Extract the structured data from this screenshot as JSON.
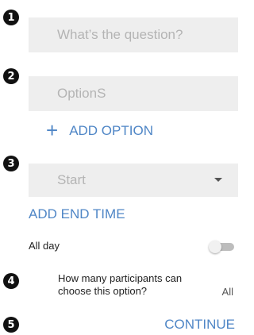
{
  "steps": [
    "1",
    "2",
    "3",
    "4",
    "5"
  ],
  "question": {
    "placeholder": "What’s the question?"
  },
  "option": {
    "placeholder": "OptionS"
  },
  "add_option": {
    "icon": "plus-icon",
    "label": "ADD OPTION"
  },
  "start": {
    "value": "Start",
    "icon": "dropdown-caret-icon"
  },
  "add_end_time": {
    "label": "ADD END TIME"
  },
  "all_day": {
    "label": "All day",
    "toggle_on": false
  },
  "participants": {
    "label": "How many participants can choose this option?",
    "value": "All"
  },
  "continue": {
    "label": "CONTINUE"
  },
  "colors": {
    "accent": "#4f86c6",
    "field_bg": "#eeeeee",
    "placeholder": "#b4b4b4",
    "badge": "#111111"
  }
}
